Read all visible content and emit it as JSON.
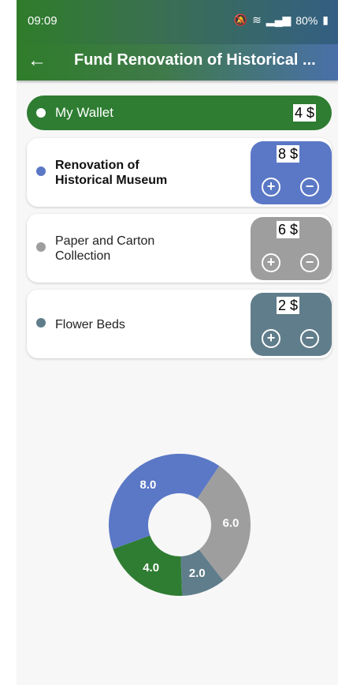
{
  "status": {
    "time": "09:09",
    "right": "80%"
  },
  "appbar": {
    "title": "Fund Renovation of Historical ..."
  },
  "wallet": {
    "label": "My Wallet",
    "value": "4 $"
  },
  "items": [
    {
      "label": "Renovation of Historical Museum",
      "value": "8 $",
      "color": "#5b78c6"
    },
    {
      "label": "Paper and Carton Collection",
      "value": "6 $",
      "color": "#9e9e9e"
    },
    {
      "label": "Flower Beds",
      "value": "2 $",
      "color": "#607d8b"
    }
  ],
  "chart_data": {
    "type": "pie",
    "slices": [
      {
        "label": "8.0",
        "value": 8.0,
        "color": "#5b78c6"
      },
      {
        "label": "6.0",
        "value": 6.0,
        "color": "#9e9e9e"
      },
      {
        "label": "2.0",
        "value": 2.0,
        "color": "#607d8b"
      },
      {
        "label": "4.0",
        "value": 4.0,
        "color": "#2e7d32"
      }
    ]
  }
}
